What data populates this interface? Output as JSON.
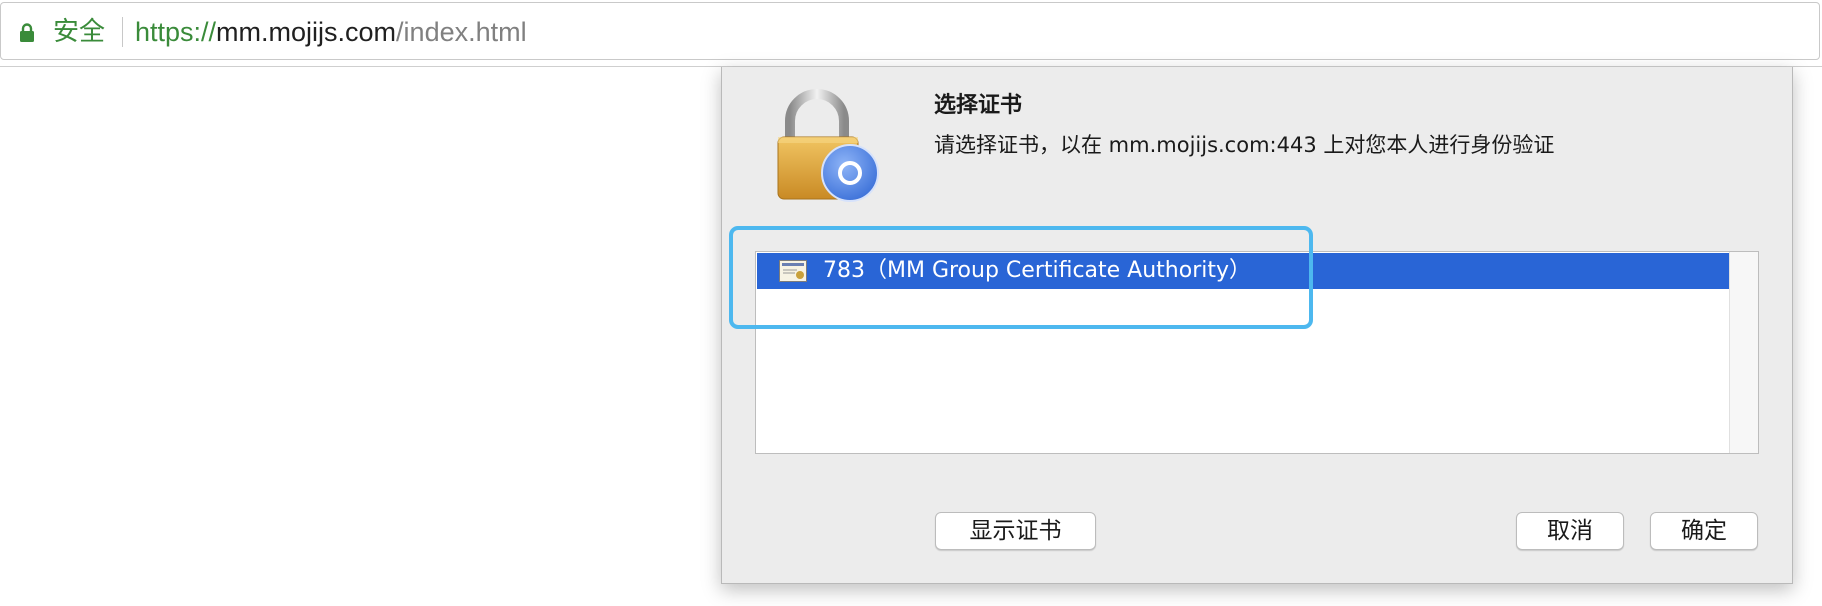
{
  "browser": {
    "secure_label": "安全",
    "url_scheme": "https://",
    "url_host": "mm.mojijs.com",
    "url_path": "/index.html",
    "secure_color": "#3a8b3a"
  },
  "dialog": {
    "icon": "padlock-chrome-icon",
    "title": "选择证书",
    "message": "请选择证书，以在 mm.mojijs.com:443 上对您本人进行身份验证",
    "certificates": [
      {
        "label": "783（MM Group Certificate Authority）",
        "selected": true,
        "icon": "certificate-icon"
      }
    ],
    "buttons": {
      "show_certificate": "显示证书",
      "cancel": "取消",
      "ok": "确定"
    },
    "selection_color": "#2965d6"
  },
  "annotation": {
    "highlight_color": "#4db8ef"
  }
}
